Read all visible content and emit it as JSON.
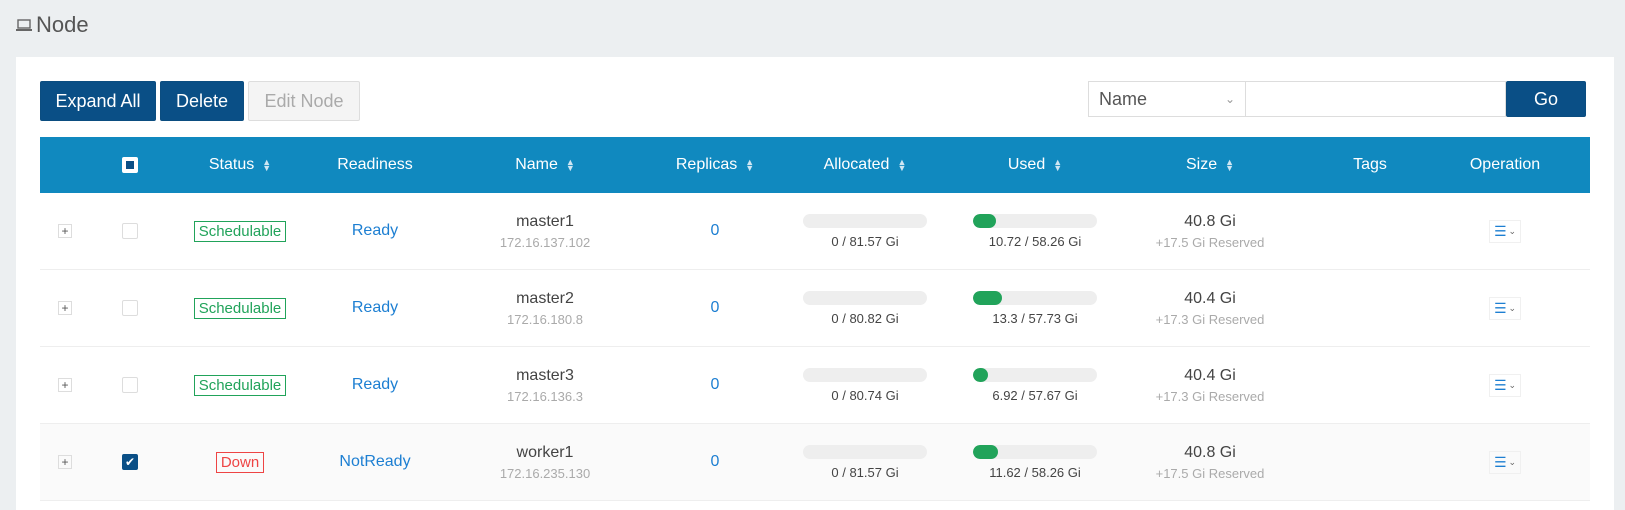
{
  "header": {
    "title": "Node",
    "icon": "laptop-icon"
  },
  "toolbar": {
    "expand_label": "Expand All",
    "delete_label": "Delete",
    "edit_label": "Edit Node",
    "search_field": "Name",
    "search_value": "",
    "go_label": "Go"
  },
  "table": {
    "headers": {
      "status": "Status",
      "readiness": "Readiness",
      "name": "Name",
      "replicas": "Replicas",
      "allocated": "Allocated",
      "used": "Used",
      "size": "Size",
      "tags": "Tags",
      "operation": "Operation"
    },
    "rows": [
      {
        "expand": "+",
        "checked": false,
        "status": "Schedulable",
        "readiness": "Ready",
        "name": "master1",
        "ip": "172.16.137.102",
        "replicas": "0",
        "allocated": "0 / 81.57 Gi",
        "allocated_frac": 0.0,
        "used": "10.72 / 58.26 Gi",
        "used_frac": 0.184,
        "size": "40.8 Gi",
        "reserved": "+17.5 Gi Reserved"
      },
      {
        "expand": "+",
        "checked": false,
        "status": "Schedulable",
        "readiness": "Ready",
        "name": "master2",
        "ip": "172.16.180.8",
        "replicas": "0",
        "allocated": "0 / 80.82 Gi",
        "allocated_frac": 0.0,
        "used": "13.3 / 57.73 Gi",
        "used_frac": 0.23,
        "size": "40.4 Gi",
        "reserved": "+17.3 Gi Reserved"
      },
      {
        "expand": "+",
        "checked": false,
        "status": "Schedulable",
        "readiness": "Ready",
        "name": "master3",
        "ip": "172.16.136.3",
        "replicas": "0",
        "allocated": "0 / 80.74 Gi",
        "allocated_frac": 0.0,
        "used": "6.92 / 57.67 Gi",
        "used_frac": 0.12,
        "size": "40.4 Gi",
        "reserved": "+17.3 Gi Reserved"
      },
      {
        "expand": "+",
        "checked": true,
        "status": "Down",
        "readiness": "NotReady",
        "name": "worker1",
        "ip": "172.16.235.130",
        "replicas": "0",
        "allocated": "0 / 81.57 Gi",
        "allocated_frac": 0.0,
        "used": "11.62 / 58.26 Gi",
        "used_frac": 0.199,
        "size": "40.8 Gi",
        "reserved": "+17.5 Gi Reserved"
      }
    ]
  },
  "colors": {
    "primary": "#0a4f86",
    "header_bg": "#1089bf",
    "ok": "#21a35a",
    "down": "#ee4444",
    "link": "#1d7fd2"
  }
}
